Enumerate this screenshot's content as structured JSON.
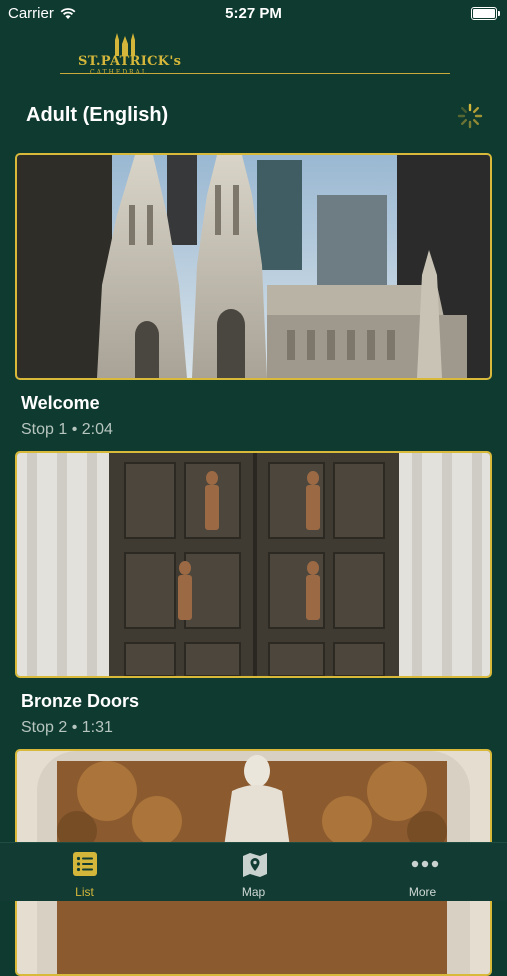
{
  "status_bar": {
    "carrier": "Carrier",
    "time": "5:27 PM"
  },
  "header": {
    "logo_text": "ST.PATRICK's",
    "logo_subtext": "CATHEDRAL",
    "section_title": "Adult (English)"
  },
  "stops": [
    {
      "title": "Welcome",
      "subtitle": "Stop 1 • 2:04",
      "image": "cathedral-spires-photo"
    },
    {
      "title": "Bronze Doors",
      "subtitle": "Stop 2 • 1:31",
      "image": "bronze-doors-photo"
    },
    {
      "title": "",
      "subtitle": "",
      "image": "altar-statue-photo"
    }
  ],
  "tabs": [
    {
      "label": "List",
      "icon": "list-icon",
      "active": true
    },
    {
      "label": "Map",
      "icon": "map-icon",
      "active": false
    },
    {
      "label": "More",
      "icon": "more-icon",
      "active": false
    }
  ],
  "colors": {
    "background": "#0e3a30",
    "accent": "#d4b73a"
  }
}
